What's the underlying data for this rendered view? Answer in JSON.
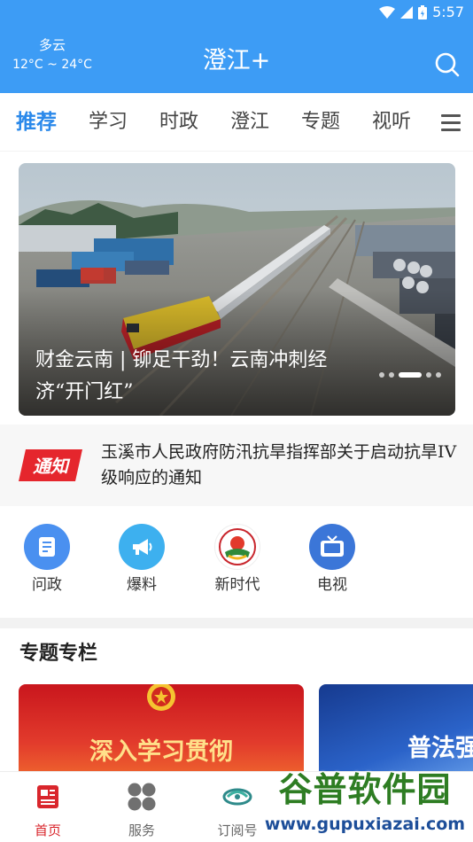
{
  "status_bar": {
    "time": "5:57"
  },
  "header": {
    "weather_condition": "多云",
    "weather_temp": "12°C ~ 24°C",
    "title": "澄江+",
    "search_icon": "search-icon"
  },
  "tabs": [
    {
      "label": "推荐",
      "active": true
    },
    {
      "label": "学习"
    },
    {
      "label": "时政"
    },
    {
      "label": "澄江"
    },
    {
      "label": "专题"
    },
    {
      "label": "视听"
    }
  ],
  "banner": {
    "caption": "财金云南 | 铆足干劲！云南冲刺经济“开门红”",
    "slide_count": 5,
    "active_slide": 3
  },
  "notice": {
    "badge": "通知",
    "text": "玉溪市人民政府防汛抗旱指挥部关于启动抗旱IV级响应的通知"
  },
  "quick_links": [
    {
      "label": "问政",
      "icon": "document-icon",
      "color": "#4a90f0"
    },
    {
      "label": "爆料",
      "icon": "megaphone-icon",
      "color": "#3db0ef"
    },
    {
      "label": "新时代",
      "icon": "emblem-icon",
      "color": "#ffffff"
    },
    {
      "label": "电视",
      "icon": "tv-icon",
      "color": "#3b76d8"
    }
  ],
  "topics": {
    "title": "专题专栏",
    "cards": [
      {
        "text": "深入学习贯彻",
        "theme": "red"
      },
      {
        "text": "普法强",
        "theme": "blue"
      }
    ]
  },
  "bottom_nav": [
    {
      "label": "首页",
      "icon": "home-news-icon",
      "active": true
    },
    {
      "label": "服务",
      "icon": "grid-icon"
    },
    {
      "label": "订阅号",
      "icon": "subscribe-icon"
    }
  ],
  "watermark": {
    "title": "谷普软件园",
    "url": "www.gupuxiazai.com"
  }
}
